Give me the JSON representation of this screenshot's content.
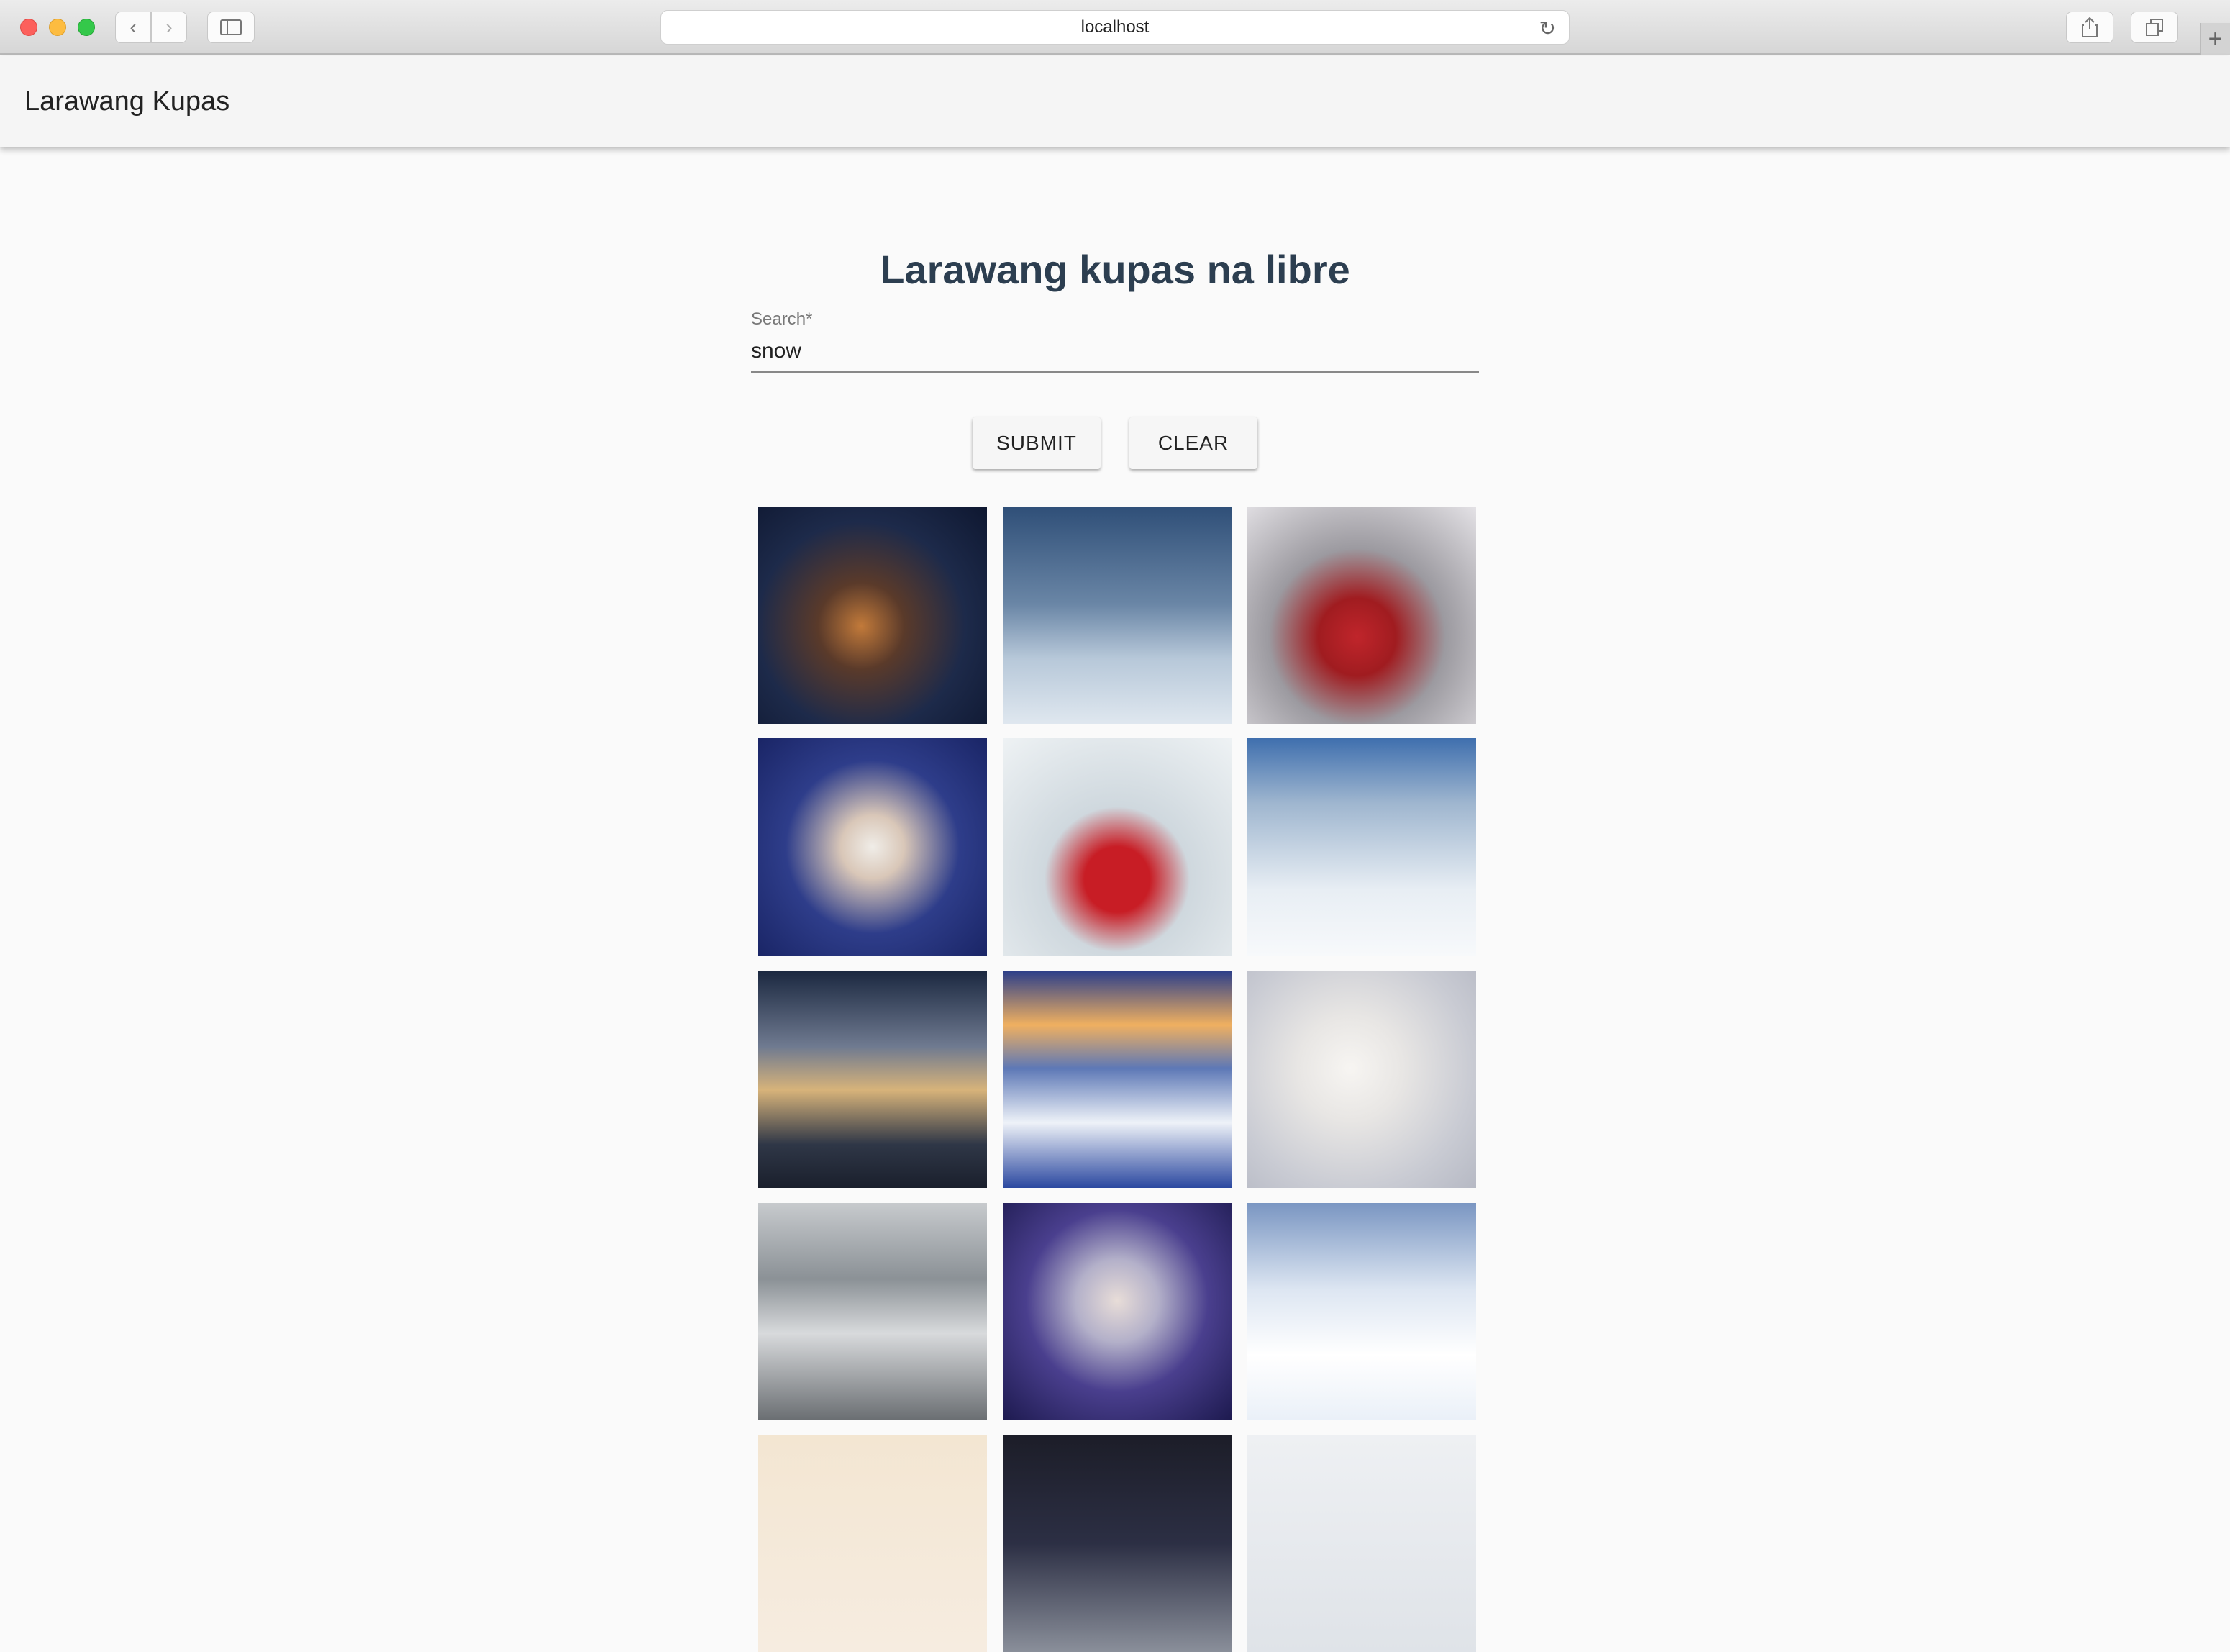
{
  "browser": {
    "url": "localhost"
  },
  "app": {
    "title": "Larawang Kupas"
  },
  "main": {
    "heading": "Larawang kupas na libre",
    "search": {
      "label": "Search*",
      "value": "snow"
    },
    "buttons": {
      "submit": "SUBMIT",
      "clear": "CLEAR"
    }
  },
  "images": [
    {
      "name": "snowy-town-night-image",
      "bg": "radial-gradient(circle at 45% 55%, #c27a3a 0%, #5a3a2a 25%, #1d2a4a 60%, #0e1730 100%)"
    },
    {
      "name": "ice-giant-image",
      "bg": "linear-gradient(180deg, #2f4f78 0%, #6a86a6 45%, #b7c8d9 70%, #dfe7ef 100%)"
    },
    {
      "name": "red-tram-image",
      "bg": "radial-gradient(circle at 48% 60%, #c0252b 0%, #a01c20 22%, #9c9aa0 50%, #e4e2e6 100%)"
    },
    {
      "name": "woman-christmas-lights-image",
      "bg": "radial-gradient(circle at 50% 50%, #f0ede8 0%, #d9c7b8 20%, #2e3d8a 55%, #1a2566 100%)"
    },
    {
      "name": "santa-bag-image",
      "bg": "radial-gradient(circle at 50% 65%, #c81d25 0%, #c81d25 18%, #cfd8de 40%, #eef2f4 100%)"
    },
    {
      "name": "snowy-forest-image",
      "bg": "linear-gradient(180deg, #3f6fae 0%, #9fb6cf 30%, #e8eef4 70%, #f7f9fb 100%)"
    },
    {
      "name": "snow-dusk-image",
      "bg": "linear-gradient(180deg, #1b2840 0%, #6f7a90 35%, #d7b37a 55%, #2f3747 80%, #1a1f2c 100%)"
    },
    {
      "name": "mountain-hut-image",
      "bg": "linear-gradient(180deg, #2b3e8a 0%, #f0b060 25%, #5d78b6 45%, #eef2f8 70%, #2b48a0 100%)"
    },
    {
      "name": "snowman-image",
      "bg": "radial-gradient(circle at 45% 45%, #f7f5f2 0%, #e8e6e4 30%, #c9cbd3 70%, #b6b9c4 100%)"
    },
    {
      "name": "blizzard-image",
      "bg": "linear-gradient(180deg, #c7cacd 0%, #8b9196 35%, #d8dadc 60%, #6a6e72 100%)"
    },
    {
      "name": "child-snow-image",
      "bg": "radial-gradient(circle at 50% 45%, #e8ddd8 0%, #b3b0c9 25%, #4a3f8e 55%, #1d1a4f 100%)"
    },
    {
      "name": "alpine-village-image",
      "bg": "linear-gradient(180deg, #7a96c2 0%, #dde6f2 40%, #ffffff 70%, #eaf0f8 100%)"
    },
    {
      "name": "warm-light-image",
      "bg": "linear-gradient(180deg, #f3e6d2 0%, #f6ece0 100%)"
    },
    {
      "name": "tree-sunset-image",
      "bg": "linear-gradient(180deg, #1c1d28 0%, #2c2f44 50%, #8a8f9a 100%)"
    },
    {
      "name": "snowflakes-image",
      "bg": "linear-gradient(180deg, #eef0f3 0%, #dfe3e8 100%)"
    }
  ]
}
